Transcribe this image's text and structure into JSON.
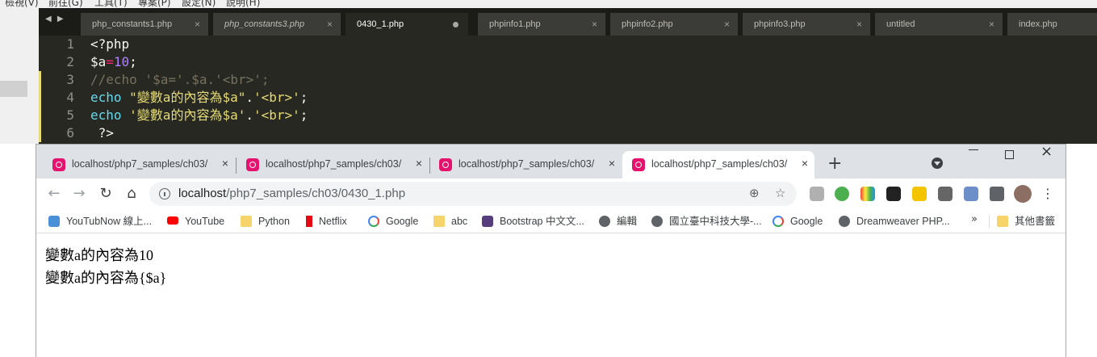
{
  "editor": {
    "menubar": [
      "檢視(V)",
      "前往(G)",
      "工具(T)",
      "專案(P)",
      "設定(N)",
      "說明(H)"
    ],
    "nav_arrows": "◀ ▶",
    "tabs": [
      {
        "label": "php_constants1.php",
        "italic": false,
        "active": false,
        "close": "×"
      },
      {
        "label": "php_constants3.php",
        "italic": true,
        "active": false,
        "close": "×"
      },
      {
        "label": "0430_1.php",
        "italic": false,
        "active": true,
        "modified": true
      },
      {
        "label": "phpinfo1.php",
        "italic": false,
        "active": false,
        "close": "×"
      },
      {
        "label": "phpinfo2.php",
        "italic": false,
        "active": false,
        "close": "×"
      },
      {
        "label": "phpinfo3.php",
        "italic": false,
        "active": false,
        "close": "×"
      },
      {
        "label": "untitled",
        "italic": false,
        "active": false,
        "close": "×"
      },
      {
        "label": "index.php",
        "italic": false,
        "active": false
      }
    ],
    "line_numbers": [
      "1",
      "2",
      "3",
      "4",
      "5",
      "6"
    ],
    "code": {
      "l1": "<?php",
      "l2_var": "$a",
      "l2_op": "=",
      "l2_num": "10",
      "l2_end": ";",
      "l3": "//echo '$a='.$a.'<br>';",
      "l4_kw": "echo",
      "l4_str": "\"變數a的內容為$a\"",
      "l4_dot": ".",
      "l4_str2": "'<br>'",
      "l4_end": ";",
      "l5_kw": "echo",
      "l5_str": "'變數a的內容為$a'",
      "l5_dot": ".",
      "l5_str2": "'<br>'",
      "l5_end": ";",
      "l6": " ?>"
    }
  },
  "browser": {
    "tabs": [
      {
        "title": "localhost/php7_samples/ch03/",
        "close": "×",
        "active": false
      },
      {
        "title": "localhost/php7_samples/ch03/",
        "close": "×",
        "active": false
      },
      {
        "title": "localhost/php7_samples/ch03/",
        "close": "×",
        "active": false
      },
      {
        "title": "localhost/php7_samples/ch03/",
        "close": "×",
        "active": true
      }
    ],
    "new_tab": "+",
    "window_close": "×",
    "nav": {
      "back": "←",
      "forward": "→",
      "reload": "↻",
      "home": "⌂"
    },
    "url_host": "localhost",
    "url_path": "/php7_samples/ch03/0430_1.php",
    "omni_icons": {
      "zoom": "⊕",
      "star": "☆"
    },
    "menu": "⋮",
    "bookmarks": [
      {
        "label": "YouTubNow 線上...",
        "icon": "youtubnow-icon",
        "color": "#4a90d9"
      },
      {
        "label": "YouTube",
        "icon": "youtube-icon",
        "color": "#ff0000"
      },
      {
        "label": "Python",
        "icon": "folder-icon",
        "color": "#f6d46b"
      },
      {
        "label": "Netflix",
        "icon": "netflix-icon",
        "color": "#e50914"
      },
      {
        "label": "Google",
        "icon": "google-icon",
        "color": "#4285f4"
      },
      {
        "label": "abc",
        "icon": "folder-icon",
        "color": "#f6d46b"
      },
      {
        "label": "Bootstrap 中文文...",
        "icon": "bootstrap-icon",
        "color": "#563d7c"
      },
      {
        "label": "編輯",
        "icon": "globe-icon",
        "color": "#5f6368"
      },
      {
        "label": "國立臺中科技大學-...",
        "icon": "globe-icon",
        "color": "#5f6368"
      },
      {
        "label": "Google",
        "icon": "google-icon",
        "color": "#4285f4"
      },
      {
        "label": "Dreamweaver PHP...",
        "icon": "globe-icon",
        "color": "#5f6368"
      }
    ],
    "bookmarks_more": "»",
    "other_bookmarks": "其他書籤",
    "output": [
      "變數a的內容為10",
      "變數a的內容為{$a}"
    ]
  },
  "colors": {
    "editor_bg": "#272822",
    "editor_tabbar": "#1b1c18",
    "chrome_tabstrip": "#dee1e6",
    "favicon": "#e5136e"
  }
}
